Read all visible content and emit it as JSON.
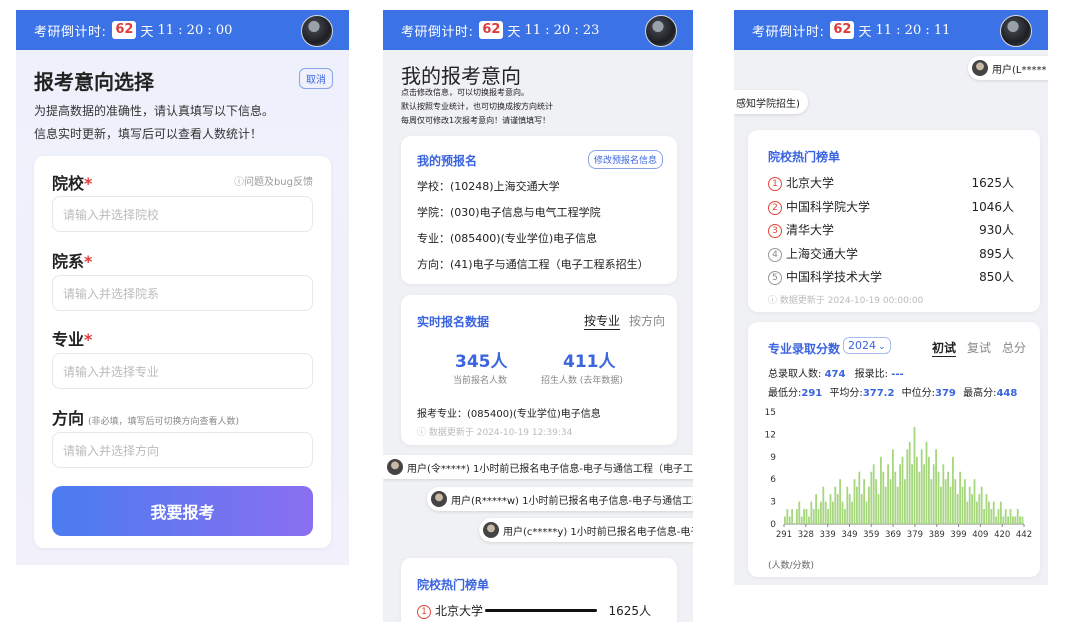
{
  "colors": {
    "accent": "#3b73e6",
    "days_badge": "#e03a3a",
    "bar": "#a6d77f",
    "stat_blue": "#3b64e0"
  },
  "screens": {
    "left": {
      "header": {
        "label": "考研倒计时:",
        "days": "62",
        "day_unit": "天",
        "time": "11 : 20 : 00"
      },
      "title": "报考意向选择",
      "cancel_label": "取消",
      "desc1": "为提高数据的准确性，请认真填写以下信息。",
      "desc2": "信息实时更新，填写后可以查看人数统计！",
      "feedback": "ⓘ问题及bug反馈",
      "fields": [
        {
          "label": "院校",
          "placeholder": "请输入并选择院校"
        },
        {
          "label": "院系",
          "placeholder": "请输入并选择院系"
        },
        {
          "label": "专业",
          "placeholder": "请输入并选择专业"
        },
        {
          "label": "方向",
          "note": "(非必填，填写后可切换方向查看人数)",
          "placeholder": "请输入并选择方向"
        }
      ],
      "submit_label": "我要报考"
    },
    "middle": {
      "header": {
        "label": "考研倒计时:",
        "days": "62",
        "day_unit": "天",
        "time": "11 : 20 : 23"
      },
      "title": "我的报考意向",
      "notes": [
        "点击修改信息，可以切换报考意向。",
        "默认按照专业统计，也可切换成按方向统计",
        "每周仅可修改1次报考意向！请谨慎填写！"
      ],
      "prereg": {
        "title": "我的预报名",
        "edit_label": "修改预报名信息",
        "rows": [
          "学校：(10248)上海交通大学",
          "学院：(030)电子信息与电气工程学院",
          "专业：(085400)(专业学位)电子信息",
          "方向：(41)电子与通信工程（电子工程系招生）"
        ]
      },
      "realtime": {
        "title": "实时报名数据",
        "tab_major": "按专业",
        "tab_dir": "按方向",
        "current": "345人",
        "current_label": "当前报名人数",
        "quota": "411人",
        "quota_label": "招生人数 (去年数据)",
        "major_line": "报考专业：(085400)(专业学位)电子信息",
        "updated": "ⓘ 数据更新于 2024-10-19 12:39:34"
      },
      "bubbles": [
        "用户(令*****) 1小时前已报名电子信息-电子与通信工程（电子工程系",
        "用户(R*****w) 1小时前已报名电子信息-电子与通信工程",
        "用户(c*****y) 1小时前已报名电子信息-电子与"
      ],
      "hot_title": "院校热门榜单",
      "hot_first": {
        "num": "1",
        "name": "北京大学",
        "count": "1625人"
      }
    },
    "right": {
      "header": {
        "label": "考研倒计时:",
        "days": "62",
        "day_unit": "天",
        "time": "11 : 20 : 11"
      },
      "bubble_top": "用户(L*****",
      "bubble_left": "感知学院招生)",
      "hot": {
        "title": "院校热门榜单",
        "items": [
          {
            "num": "1",
            "name": "北京大学",
            "count": "1625人"
          },
          {
            "num": "2",
            "name": "中国科学院大学",
            "count": "1046人"
          },
          {
            "num": "3",
            "name": "清华大学",
            "count": "930人"
          },
          {
            "num": "4",
            "name": "上海交通大学",
            "count": "895人"
          },
          {
            "num": "5",
            "name": "中国科学技术大学",
            "count": "850人"
          }
        ],
        "updated": "ⓘ 数据更新于 2024-10-19 00:00:00"
      },
      "scores": {
        "title": "专业录取分数",
        "year": "2024",
        "tabs": [
          "初试",
          "复试",
          "总分"
        ],
        "total_label": "总录取人数:",
        "total_val": "474",
        "ratio_label": "报录比:",
        "ratio_val": "---",
        "min_label": "最低分:",
        "min_val": "291",
        "avg_label": "平均分:",
        "avg_val": "377.2",
        "med_label": "中位分:",
        "med_val": "379",
        "max_label": "最高分:",
        "max_val": "448",
        "unit": "(人数/分数)"
      }
    }
  },
  "chart_data": {
    "type": "bar",
    "xlabel": "",
    "ylabel": "",
    "x_tick_labels": [
      "291",
      "328",
      "339",
      "349",
      "359",
      "369",
      "379",
      "389",
      "399",
      "409",
      "420",
      "442"
    ],
    "ylim": [
      0,
      15
    ],
    "y_ticks": [
      0,
      3,
      6,
      9,
      12,
      15
    ],
    "grid": false,
    "values": [
      1,
      2,
      1,
      2,
      0,
      2,
      3,
      1,
      2,
      2,
      1,
      3,
      2,
      4,
      2,
      3,
      5,
      3,
      2,
      4,
      3,
      5,
      4,
      6,
      3,
      2,
      5,
      4,
      3,
      6,
      5,
      7,
      4,
      6,
      3,
      5,
      7,
      8,
      6,
      4,
      9,
      7,
      5,
      8,
      6,
      10,
      7,
      5,
      8,
      9,
      6,
      10,
      11,
      8,
      13,
      9,
      7,
      10,
      8,
      11,
      9,
      6,
      8,
      10,
      7,
      5,
      8,
      6,
      7,
      5,
      9,
      6,
      4,
      7,
      5,
      6,
      3,
      5,
      4,
      6,
      3,
      4,
      5,
      2,
      4,
      3,
      2,
      3,
      1,
      2,
      3,
      1,
      2,
      1,
      2,
      1,
      1,
      2,
      1,
      1
    ]
  }
}
